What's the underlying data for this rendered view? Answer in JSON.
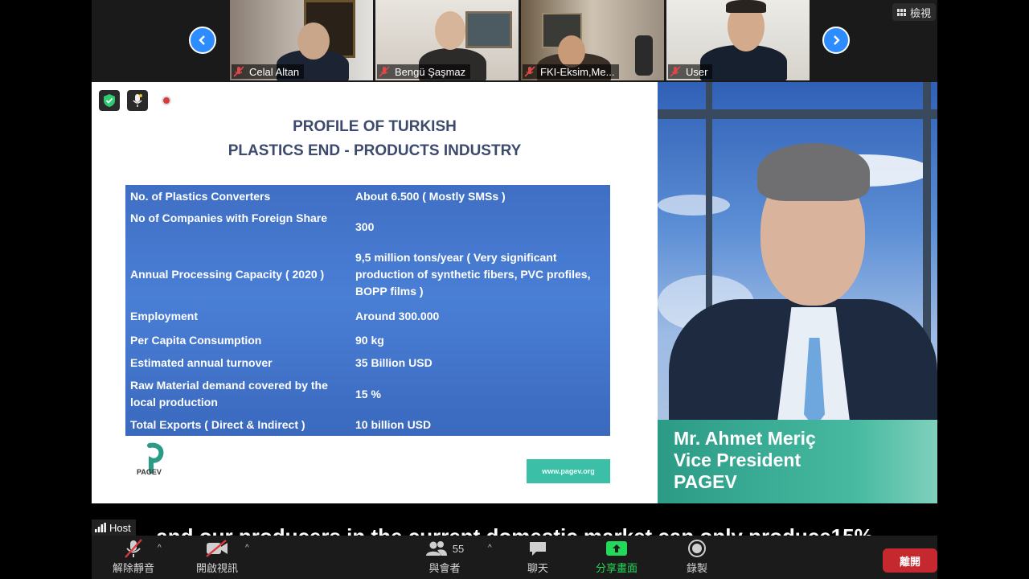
{
  "view_button": {
    "label": "檢視"
  },
  "participants": [
    {
      "name": "Celal Altan"
    },
    {
      "name": "Bengü Şaşmaz"
    },
    {
      "name": "FKI-Eksim,Me..."
    },
    {
      "name": "User"
    }
  ],
  "slide": {
    "title_line1": "PROFILE OF TURKISH",
    "title_line2": "PLASTICS END - PRODUCTS INDUSTRY",
    "rows": [
      {
        "label": "No. of  Plastics Converters",
        "value": "About 6.500 ( Mostly SMSs )"
      },
      {
        "label": "No  of Companies with Foreign Share",
        "value": "300"
      },
      {
        "label": "Annual Processing Capacity  ( 2020 )",
        "value": "9,5 million tons/year  ( Very significant production of synthetic fibers, PVC profiles, BOPP films )"
      },
      {
        "label": "Employment",
        "value": "Around  300.000"
      },
      {
        "label": "Per Capita Consumption",
        "value": "90 kg"
      },
      {
        "label": "Estimated annual turnover",
        "value": "35 Billion USD"
      },
      {
        "label": "Raw Material demand covered by the local production",
        "value": "15 %"
      },
      {
        "label": "Total Exports ( Direct & Indirect )",
        "value": "10 billion USD"
      }
    ],
    "logo_text": "PAGEV",
    "site_label": "www.pagev.org"
  },
  "speaker": {
    "line1": "Mr. Ahmet Meriç",
    "line2": "Vice President",
    "line3": "PAGEV"
  },
  "host_tag": "Host",
  "caption": "and our producers in the current domestic market can only produce15%",
  "toolbar": {
    "unmute_label": "解除靜音",
    "start_video_label": "開啟視訊",
    "participants_label": "與會者",
    "participants_count": "55",
    "chat_label": "聊天",
    "share_label": "分享畫面",
    "record_label": "錄製",
    "leave_label": "離開"
  },
  "colors": {
    "zoom_blue": "#2d8cff",
    "share_green": "#23d959",
    "leave_red": "#c5292f",
    "table_blue": "#4a7fd6",
    "ribbon_teal": "#46b9a0"
  }
}
